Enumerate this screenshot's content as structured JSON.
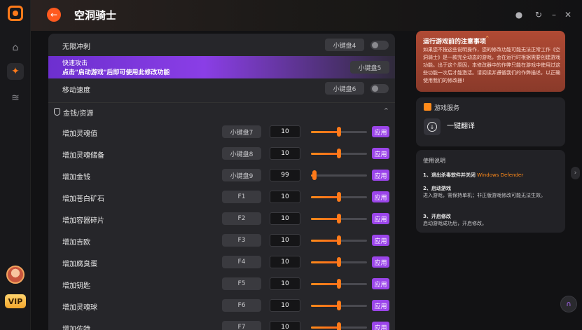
{
  "header": {
    "title": "空洞骑士"
  },
  "top_rows": [
    {
      "label": "无限冲刺",
      "key": "小键盘4"
    },
    {
      "label": "移动速度",
      "key": "小键盘6"
    }
  ],
  "promo": {
    "line1": "快速攻击",
    "line2": "点击\"启动游戏\"后即可使用此修改功能",
    "key": "小键盘5"
  },
  "section": {
    "label": "金钱/资源"
  },
  "resource_rows": [
    {
      "label": "增加灵魂值",
      "key": "小键盘7",
      "value": "10",
      "level": 0.5
    },
    {
      "label": "增加灵魂储备",
      "key": "小键盘8",
      "value": "10",
      "level": 0.5
    },
    {
      "label": "增加金钱",
      "key": "小键盘9",
      "value": "99",
      "level": 0.06
    },
    {
      "label": "增加苍白矿石",
      "key": "F1",
      "value": "10",
      "level": 0.5
    },
    {
      "label": "增加容器碎片",
      "key": "F2",
      "value": "10",
      "level": 0.5
    },
    {
      "label": "增加吉欧",
      "key": "F3",
      "value": "10",
      "level": 0.5
    },
    {
      "label": "增加腐臭蛋",
      "key": "F4",
      "value": "10",
      "level": 0.5
    },
    {
      "label": "增加钥匙",
      "key": "F5",
      "value": "10",
      "level": 0.5
    },
    {
      "label": "增加灵魂球",
      "key": "F6",
      "value": "10",
      "level": 0.5
    },
    {
      "label": "增加佐特",
      "key": "F7",
      "value": "10",
      "level": 0.5
    }
  ],
  "apply_label": "应用",
  "notice": {
    "title": "运行游戏前的注意事项",
    "body": "如果您不按这些说明操作，您的修改功能可能无法正常工作《空洞骑士》是一款完全动态的游戏，会在运行时根据需要创建游戏功能。出于这个原因，本修改器中的作弊只能在游戏中使用过这些功能一次后才能激活。请阅读并遵循我们的作弊描述，以正确使用我们的修改器!"
  },
  "service": {
    "title": "游戏服务",
    "translate_label": "一键翻译"
  },
  "usage": {
    "title": "使用说明",
    "steps": [
      {
        "title": "1、退出杀毒软件并关闭",
        "highlight": "Windows Defender",
        "desc": ""
      },
      {
        "title": "2、启动游戏",
        "highlight": "",
        "desc": "进入游戏，需保持单机；非正版游戏修改可能无法生效。"
      },
      {
        "title": "3、开启修改",
        "highlight": "",
        "desc": "启动游戏成功后，开启修改。"
      }
    ]
  },
  "vip_label": "VIP",
  "colors": {
    "accent": "#ff7a1a",
    "purple": "#9b45ea",
    "notice": "#a8452f"
  }
}
